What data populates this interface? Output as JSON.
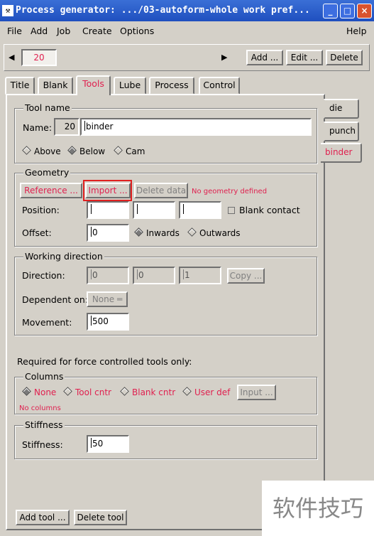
{
  "window": {
    "title": "Process generator: .../03-autoform-whole work pref...",
    "icon": "app-icon",
    "controls": {
      "minimize": "_",
      "maximize": "□",
      "close": "×"
    }
  },
  "menubar": {
    "file": "File",
    "add": "Add",
    "job": "Job",
    "create": "Create",
    "options": "Options",
    "help": "Help"
  },
  "nav": {
    "current_tool": "20",
    "add": "Add ...",
    "edit": "Edit ...",
    "delete": "Delete"
  },
  "tabs": {
    "title": "Title",
    "blank": "Blank",
    "tools": "Tools",
    "lube": "Lube",
    "process": "Process",
    "control": "Control"
  },
  "side_tabs": {
    "die": "die",
    "punch": "punch",
    "binder": "binder"
  },
  "tool_name": {
    "group": "Tool name",
    "name_label": "Name:",
    "number": "20",
    "name_value": "binder",
    "above": "Above",
    "below": "Below",
    "cam": "Cam"
  },
  "geometry": {
    "group": "Geometry",
    "reference": "Reference ...",
    "import": "Import ...",
    "delete_data": "Delete data",
    "status": "No geometry defined",
    "position_label": "Position:",
    "blank_contact": "Blank contact",
    "offset_label": "Offset:",
    "offset_value": "0",
    "inwards": "Inwards",
    "outwards": "Outwards"
  },
  "working_direction": {
    "group": "Working direction",
    "direction_label": "Direction:",
    "dir_x": "0",
    "dir_y": "0",
    "dir_z": "1",
    "copy": "Copy ...",
    "dependent_label": "Dependent on:",
    "dependent_value": "None",
    "movement_label": "Movement:",
    "movement_value": "500"
  },
  "force": {
    "heading": "Required for force controlled tools only:"
  },
  "columns": {
    "group": "Columns",
    "none": "None",
    "tool_cntr": "Tool cntr",
    "blank_cntr": "Blank cntr",
    "user_def": "User def",
    "input": "Input ...",
    "status": "No columns"
  },
  "stiffness": {
    "group": "Stiffness",
    "label": "Stiffness:",
    "value": "50"
  },
  "footer": {
    "add_tool": "Add tool ...",
    "delete_tool": "Delete tool"
  },
  "watermark": "软件技巧",
  "colors": {
    "accent_red": "#e0204f",
    "titlebar_blue": "#1f4fbf",
    "panel": "#d4d0c8"
  }
}
